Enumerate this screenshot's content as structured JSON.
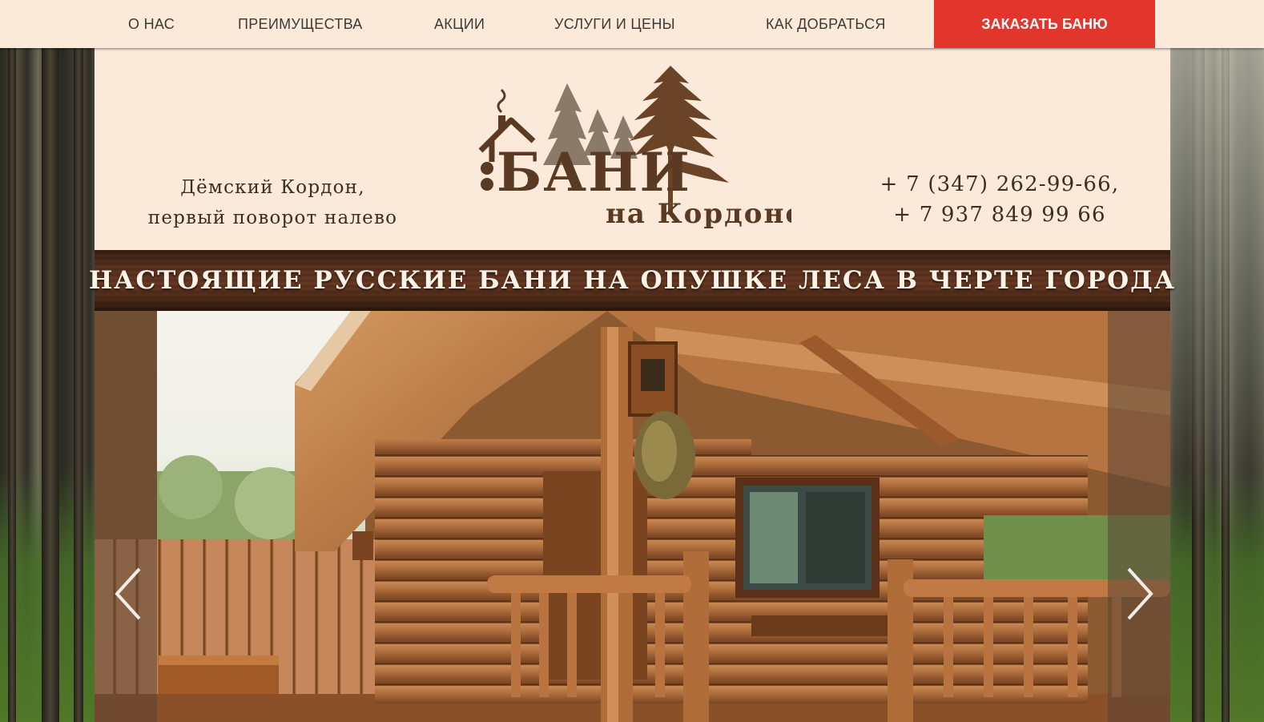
{
  "nav": {
    "items": [
      {
        "label": "О НАС"
      },
      {
        "label": "ПРЕИМУЩЕСТВА"
      },
      {
        "label": "АКЦИИ"
      },
      {
        "label": "УСЛУГИ И ЦЕНЫ"
      },
      {
        "label": "КАК ДОБРАТЬСЯ"
      }
    ],
    "cta_label": "ЗАКАЗАТЬ БАНЮ"
  },
  "header": {
    "address_line1": "Дёмский Кордон,",
    "address_line2": "первый поворот налево",
    "logo_word1": "БАНИ",
    "logo_word2": "на Кордоне",
    "phone1": "+ 7 (347) 262-99-66,",
    "phone2": "+ 7 937 849 99 66"
  },
  "banner": {
    "text": "НАСТОЯЩИЕ РУССКИЕ БАНИ НА ОПУШКЕ ЛЕСА В ЧЕРТЕ ГОРОДА"
  },
  "slider": {
    "prev_icon": "chevron-left-icon",
    "next_icon": "chevron-right-icon"
  },
  "colors": {
    "nav_bg": "#fbe9da",
    "cta_bg": "#e2352b",
    "text_brown": "#3b2e22",
    "logo_brown": "#5a3a22"
  }
}
